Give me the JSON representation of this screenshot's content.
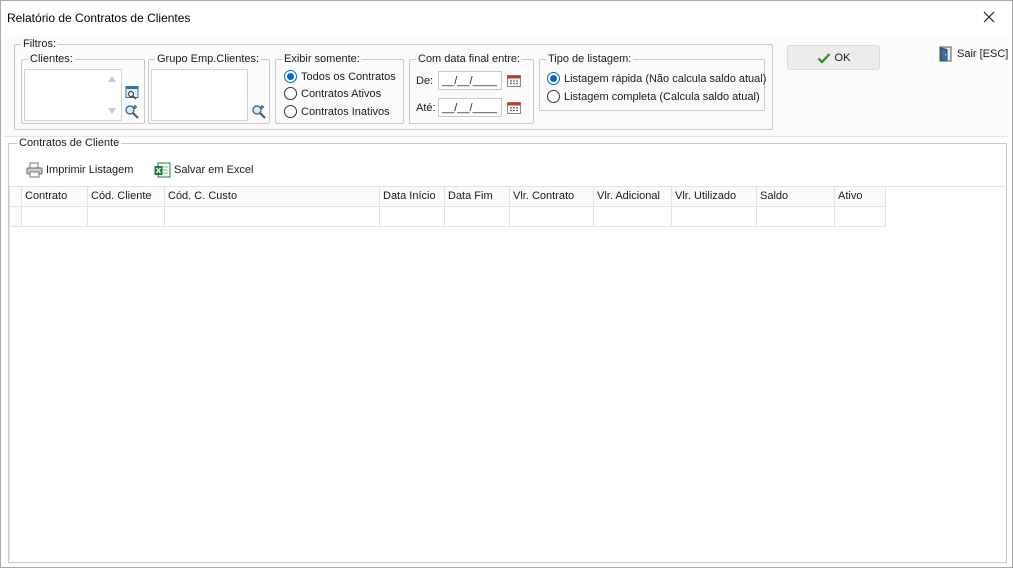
{
  "window": {
    "title": "Relatório de Contratos de Clientes"
  },
  "filters": {
    "legend": "Filtros:",
    "clientes": {
      "legend": "Clientes:"
    },
    "grupo": {
      "legend": "Grupo Emp.Clientes:"
    },
    "exibir": {
      "legend": "Exibir somente:",
      "options": [
        "Todos os Contratos",
        "Contratos Ativos",
        "Contratos Inativos"
      ],
      "selected_index": 0
    },
    "data_final": {
      "legend": "Com data final entre:",
      "from_label": "De:",
      "to_label": "Até:",
      "from_value": "__/__/____",
      "to_value": "__/__/____"
    },
    "tipo_listagem": {
      "legend": "Tipo de listagem:",
      "options": [
        "Listagem rápida (Não calcula saldo atual)",
        "Listagem completa (Calcula saldo atual)"
      ],
      "selected_index": 0
    }
  },
  "actions": {
    "ok_label": "OK",
    "exit_label": "Sair [ESC]"
  },
  "contracts": {
    "legend": "Contratos de Cliente",
    "print_label": "Imprimir Listagem",
    "excel_label": "Salvar em Excel",
    "columns": [
      "Contrato",
      "Cód. Cliente",
      "Cód. C. Custo",
      "Data Início",
      "Data Fim",
      "Vlr. Contrato",
      "Vlr. Adicional",
      "Vlr. Utilizado",
      "Saldo",
      "Ativo"
    ]
  },
  "colors": {
    "accent": "#0a64c8",
    "ok_check": "#2e8b2e",
    "excel_green": "#1f7a3a"
  }
}
